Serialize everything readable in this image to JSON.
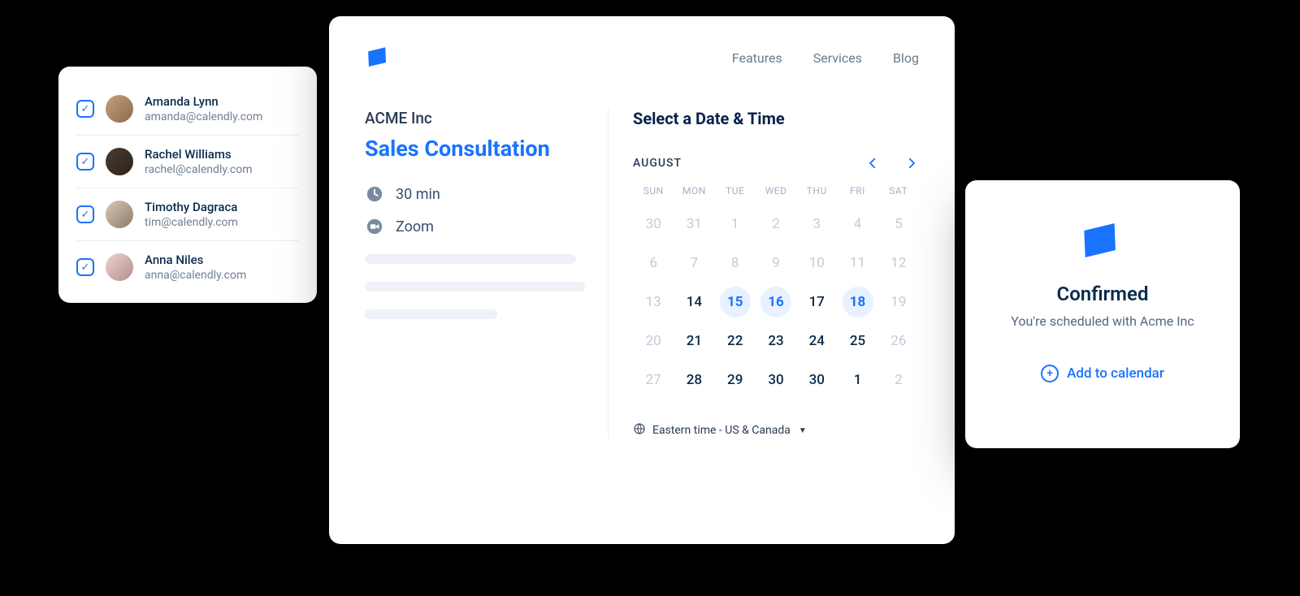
{
  "users": [
    {
      "name": "Amanda Lynn",
      "email": "amanda@calendly.com"
    },
    {
      "name": "Rachel Williams",
      "email": "rachel@calendly.com"
    },
    {
      "name": "Timothy Dagraca",
      "email": "tim@calendly.com"
    },
    {
      "name": "Anna Niles",
      "email": "anna@calendly.com"
    }
  ],
  "nav": {
    "features": "Features",
    "services": "Services",
    "blog": "Blog"
  },
  "event": {
    "company": "ACME Inc",
    "title": "Sales Consultation",
    "duration": "30 min",
    "location": "Zoom"
  },
  "calendar": {
    "section_title": "Select a Date & Time",
    "month": "AUGUST",
    "dow": [
      "SUN",
      "MON",
      "TUE",
      "WED",
      "THU",
      "FRI",
      "SAT"
    ],
    "weeks": [
      [
        {
          "n": "30",
          "cls": "off"
        },
        {
          "n": "31",
          "cls": "off"
        },
        {
          "n": "1",
          "cls": "off"
        },
        {
          "n": "2",
          "cls": "off"
        },
        {
          "n": "3",
          "cls": "off"
        },
        {
          "n": "4",
          "cls": "off"
        },
        {
          "n": "5",
          "cls": "off"
        }
      ],
      [
        {
          "n": "6",
          "cls": "off"
        },
        {
          "n": "7",
          "cls": "off"
        },
        {
          "n": "8",
          "cls": "off"
        },
        {
          "n": "9",
          "cls": "off"
        },
        {
          "n": "10",
          "cls": "off"
        },
        {
          "n": "11",
          "cls": "off"
        },
        {
          "n": "12",
          "cls": "off"
        }
      ],
      [
        {
          "n": "13",
          "cls": "off"
        },
        {
          "n": "14",
          "cls": "on"
        },
        {
          "n": "15",
          "cls": "avail"
        },
        {
          "n": "16",
          "cls": "avail"
        },
        {
          "n": "17",
          "cls": "on"
        },
        {
          "n": "18",
          "cls": "avail"
        },
        {
          "n": "19",
          "cls": "off"
        }
      ],
      [
        {
          "n": "20",
          "cls": "off"
        },
        {
          "n": "21",
          "cls": "on"
        },
        {
          "n": "22",
          "cls": "on"
        },
        {
          "n": "23",
          "cls": "on"
        },
        {
          "n": "24",
          "cls": "on"
        },
        {
          "n": "25",
          "cls": "on"
        },
        {
          "n": "26",
          "cls": "off"
        }
      ],
      [
        {
          "n": "27",
          "cls": "off"
        },
        {
          "n": "28",
          "cls": "on"
        },
        {
          "n": "29",
          "cls": "on"
        },
        {
          "n": "30",
          "cls": "on"
        },
        {
          "n": "30",
          "cls": "on"
        },
        {
          "n": "1",
          "cls": "on"
        },
        {
          "n": "2",
          "cls": "off"
        }
      ]
    ],
    "timezone": "Eastern time - US & Canada"
  },
  "confirm": {
    "title": "Confirmed",
    "subtitle": "You're scheduled with Acme Inc",
    "add_label": "Add to calendar"
  }
}
